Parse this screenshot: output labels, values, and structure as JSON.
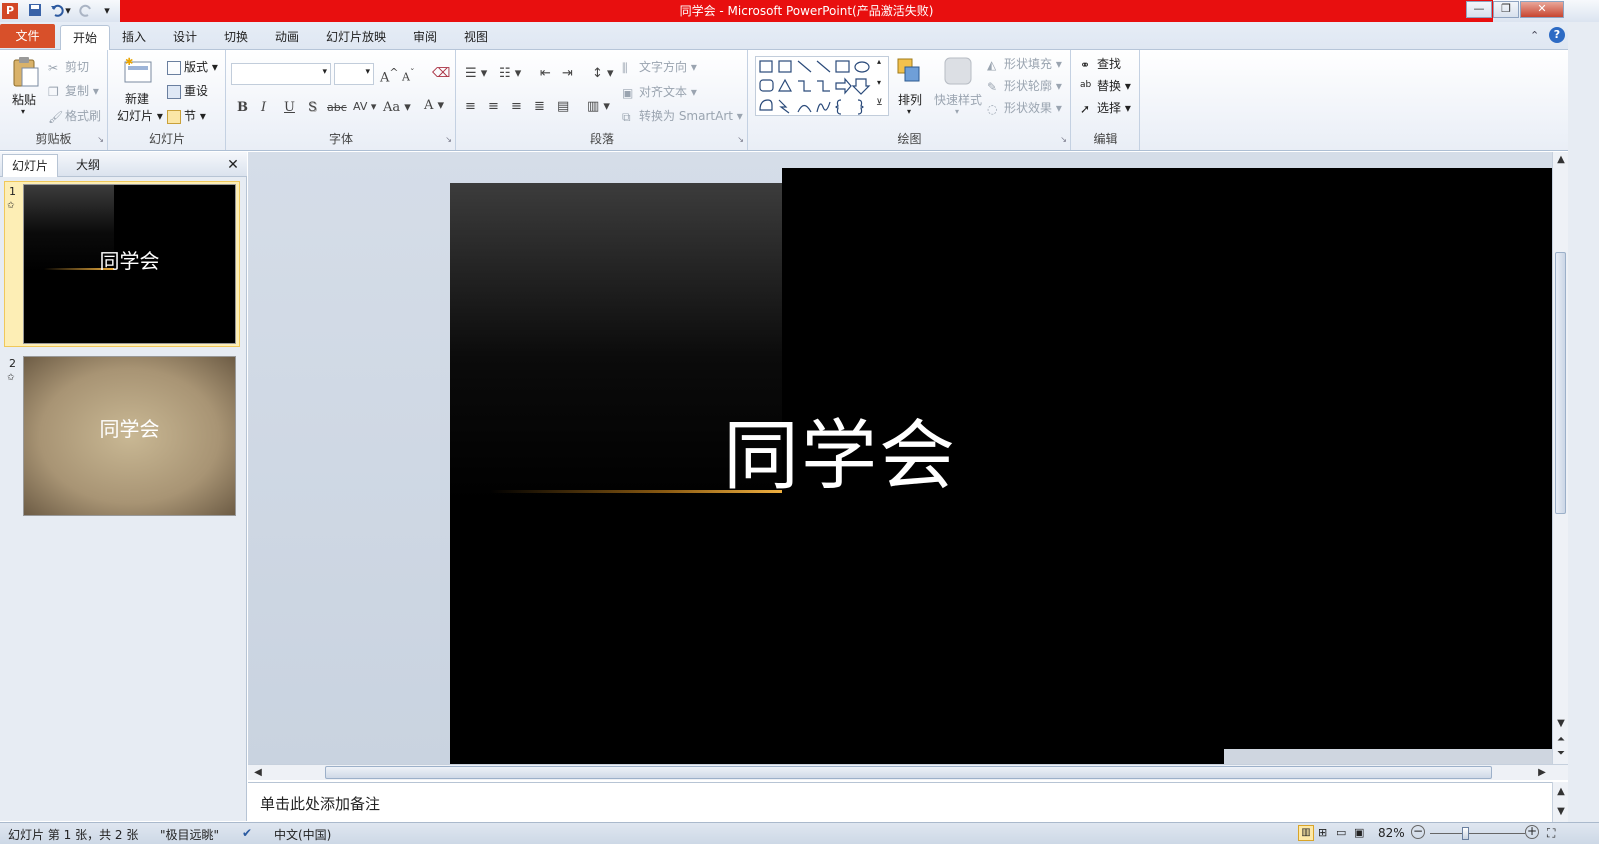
{
  "window": {
    "title": "同学会 - Microsoft PowerPoint(产品激活失败)",
    "app_icon": "P",
    "title_bar_color": "#e80f0f"
  },
  "quick_access": {
    "icons": [
      "save-icon",
      "undo-icon",
      "redo-icon",
      "customize-icon"
    ]
  },
  "window_controls": {
    "minimize": "—",
    "restore": "❐",
    "close": "✕"
  },
  "ribbon_tabs": [
    {
      "label": "文件"
    },
    {
      "label": "开始"
    },
    {
      "label": "插入"
    },
    {
      "label": "设计"
    },
    {
      "label": "切换"
    },
    {
      "label": "动画"
    },
    {
      "label": "幻灯片放映"
    },
    {
      "label": "审阅"
    },
    {
      "label": "视图"
    }
  ],
  "ribbon": {
    "clipboard": {
      "label": "剪贴板",
      "paste": "粘贴",
      "cut": "剪切",
      "copy": "复制",
      "format_painter": "格式刷"
    },
    "slides": {
      "label": "幻灯片",
      "new_slide_1": "新建",
      "new_slide_2": "幻灯片",
      "layout": "版式",
      "reset": "重设",
      "section": "节"
    },
    "font": {
      "label": "字体",
      "bold": "B",
      "italic": "I",
      "underline": "U",
      "shadow": "S",
      "strike": "abc",
      "spacing": "AV",
      "case": "Aa",
      "color": "A",
      "grow": "A",
      "shrink": "A"
    },
    "paragraph": {
      "label": "段落",
      "text_direction": "文字方向",
      "align_text": "对齐文本",
      "smartart": "转换为 SmartArt"
    },
    "drawing": {
      "label": "绘图",
      "arrange": "排列",
      "quick_styles": "快速样式",
      "shape_fill": "形状填充",
      "shape_outline": "形状轮廓",
      "shape_effects": "形状效果"
    },
    "editing": {
      "label": "编辑",
      "find": "查找",
      "replace": "替换",
      "select": "选择"
    }
  },
  "pane_tabs": {
    "slides": "幻灯片",
    "outline": "大纲",
    "close": "✕"
  },
  "thumbnails": [
    {
      "num": "1",
      "title": "同学会"
    },
    {
      "num": "2",
      "title": "同学会"
    }
  ],
  "slide": {
    "title": "同学会"
  },
  "notes": {
    "placeholder": "单击此处添加备注"
  },
  "status": {
    "slide_info": "幻灯片 第 1 张，共 2 张",
    "theme": "\"极目远眺\"",
    "language": "中文(中国)",
    "zoom": "82%"
  }
}
